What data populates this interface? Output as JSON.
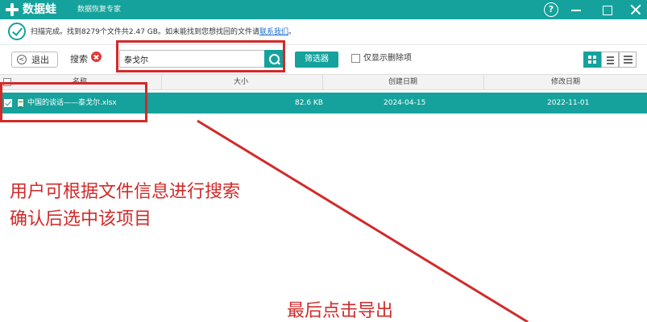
{
  "titlebar": {
    "app_name": "数据蛙",
    "app_subtitle": "数据恢复专家",
    "help": "?"
  },
  "status": {
    "text": "扫描完成。找到8279个文件共2.47 GB。如未能找到您想找回的文件请",
    "link": "联系我们",
    "suffix": "。"
  },
  "toolbar": {
    "back_label": "退出",
    "back_icon": "<",
    "search_label": "搜索",
    "search_value": "泰戈尔",
    "filter_label": "筛选器",
    "show_deleted_label": "仅显示删除项"
  },
  "table": {
    "columns": [
      "名称",
      "大小",
      "创建日期",
      "修改日期"
    ],
    "rows": [
      {
        "name": "中国的谈话——泰戈尔.xlsx",
        "size": "82.6 KB",
        "created": "2024-04-15",
        "modified": "2022-11-01"
      }
    ]
  },
  "annotations": {
    "line1": "用户可根据文件信息进行搜索",
    "line2": "确认后选中该项目",
    "line3": "最后点击导出"
  },
  "colors": {
    "brand": "#15a29c",
    "annotation": "#d12a2a",
    "link": "#1a6fd6"
  },
  "icons": [
    "logo-plus-icon",
    "help-icon",
    "minimize-icon",
    "maximize-icon",
    "close-icon",
    "check-circle-icon",
    "back-arrow-icon",
    "clear-search-icon",
    "search-icon",
    "grid-view-icon",
    "list-view-icon",
    "detail-view-icon",
    "checkbox-icon",
    "excel-file-icon"
  ]
}
